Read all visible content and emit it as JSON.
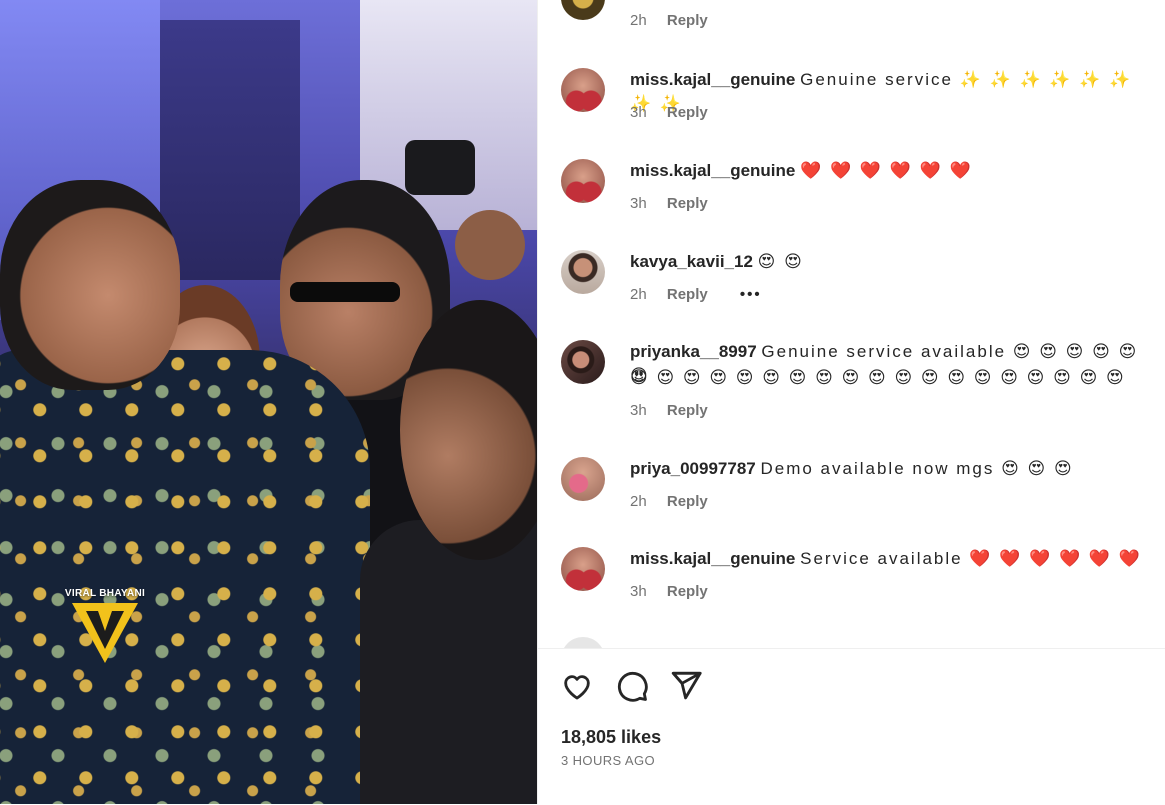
{
  "watermark": {
    "text": "VIRAL BHAYANI"
  },
  "comments": [
    {
      "username": "",
      "text": "",
      "time": "2h",
      "reply": "Reply",
      "avatar": "gold-avatar"
    },
    {
      "username": "miss.kajal__genuine",
      "text": "Genuine service ✨ ✨ ✨ ✨ ✨ ✨ ✨ ✨",
      "time": "3h",
      "reply": "Reply",
      "avatar": "profile-avatar"
    },
    {
      "username": "miss.kajal__genuine",
      "text": "❤️ ❤️ ❤️ ❤️ ❤️ ❤️",
      "time": "3h",
      "reply": "Reply",
      "avatar": "profile-avatar"
    },
    {
      "username": "kavya_kavii_12",
      "text": "😍 😍",
      "time": "2h",
      "reply": "Reply",
      "more": "•••",
      "avatar": "profile-avatar"
    },
    {
      "username": "priyanka__8997",
      "text": "Genuine service available 😍 😍 😍 😍 😍 😍",
      "text2": "😍 😍 😍 😍 😍 😍 😍 😍 😍 😍 😍 😍 😍 😍 😍 😍 😍 😍 😍",
      "time": "3h",
      "reply": "Reply",
      "avatar": "profile-avatar"
    },
    {
      "username": "priya_00997787",
      "text": "Demo available now mgs 😍 😍 😍",
      "time": "2h",
      "reply": "Reply",
      "avatar": "profile-avatar"
    },
    {
      "username": "miss.kajal__genuine",
      "text": "Service available ❤️ ❤️ ❤️ ❤️ ❤️ ❤️",
      "time": "3h",
      "reply": "Reply",
      "avatar": "profile-avatar"
    }
  ],
  "actions": {
    "icons": [
      "heart-icon",
      "comment-icon",
      "share-icon"
    ],
    "likes": "18,805 likes",
    "time_ago": "3 HOURS AGO"
  }
}
